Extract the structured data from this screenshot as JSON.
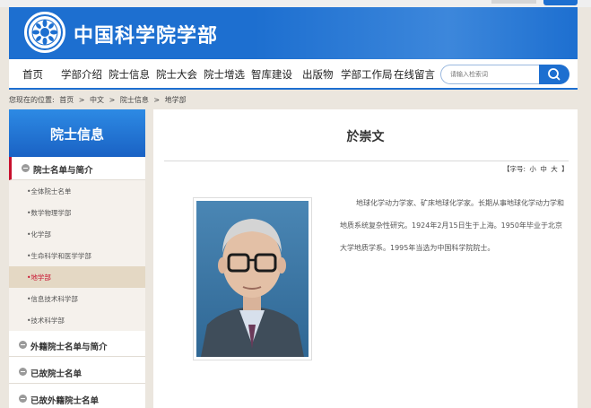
{
  "site": {
    "title": "中国科学院学部"
  },
  "nav": {
    "items": [
      "首页",
      "学部介绍",
      "院士信息",
      "院士大会",
      "院士增选",
      "智库建设",
      "出版物",
      "学部工作局",
      "在线留言"
    ],
    "search_placeholder": "请输入检索词"
  },
  "breadcrumb": {
    "prefix": "您现在的位置:",
    "items": [
      "首页",
      "中文",
      "院士信息",
      "地学部"
    ],
    "sep": ">"
  },
  "sidebar": {
    "title": "院士信息",
    "categories": [
      "院士名单与简介",
      "外籍院士名单与简介",
      "已故院士名单",
      "已故外籍院士名单"
    ],
    "subitems": [
      "•全体院士名单",
      "•数学物理学部",
      "•化学部",
      "•生命科学和医学学部",
      "•地学部",
      "•信息技术科学部",
      "•技术科学部"
    ],
    "selected_subitem": "•地学部"
  },
  "main": {
    "name": "於崇文",
    "font_size": {
      "prefix": "【字号:",
      "small": "小",
      "medium": "中",
      "large": "大",
      "suffix": "】"
    },
    "bio": "地球化学动力学家、矿床地球化学家。长期从事地球化学动力学和地质系统复杂性研究。1924年2月15日生于上海。1950年毕业于北京大学地质学系。1995年当选为中国科学院院士。"
  },
  "colors": {
    "brand": "#1d6fd0",
    "accent": "#c8102e"
  }
}
